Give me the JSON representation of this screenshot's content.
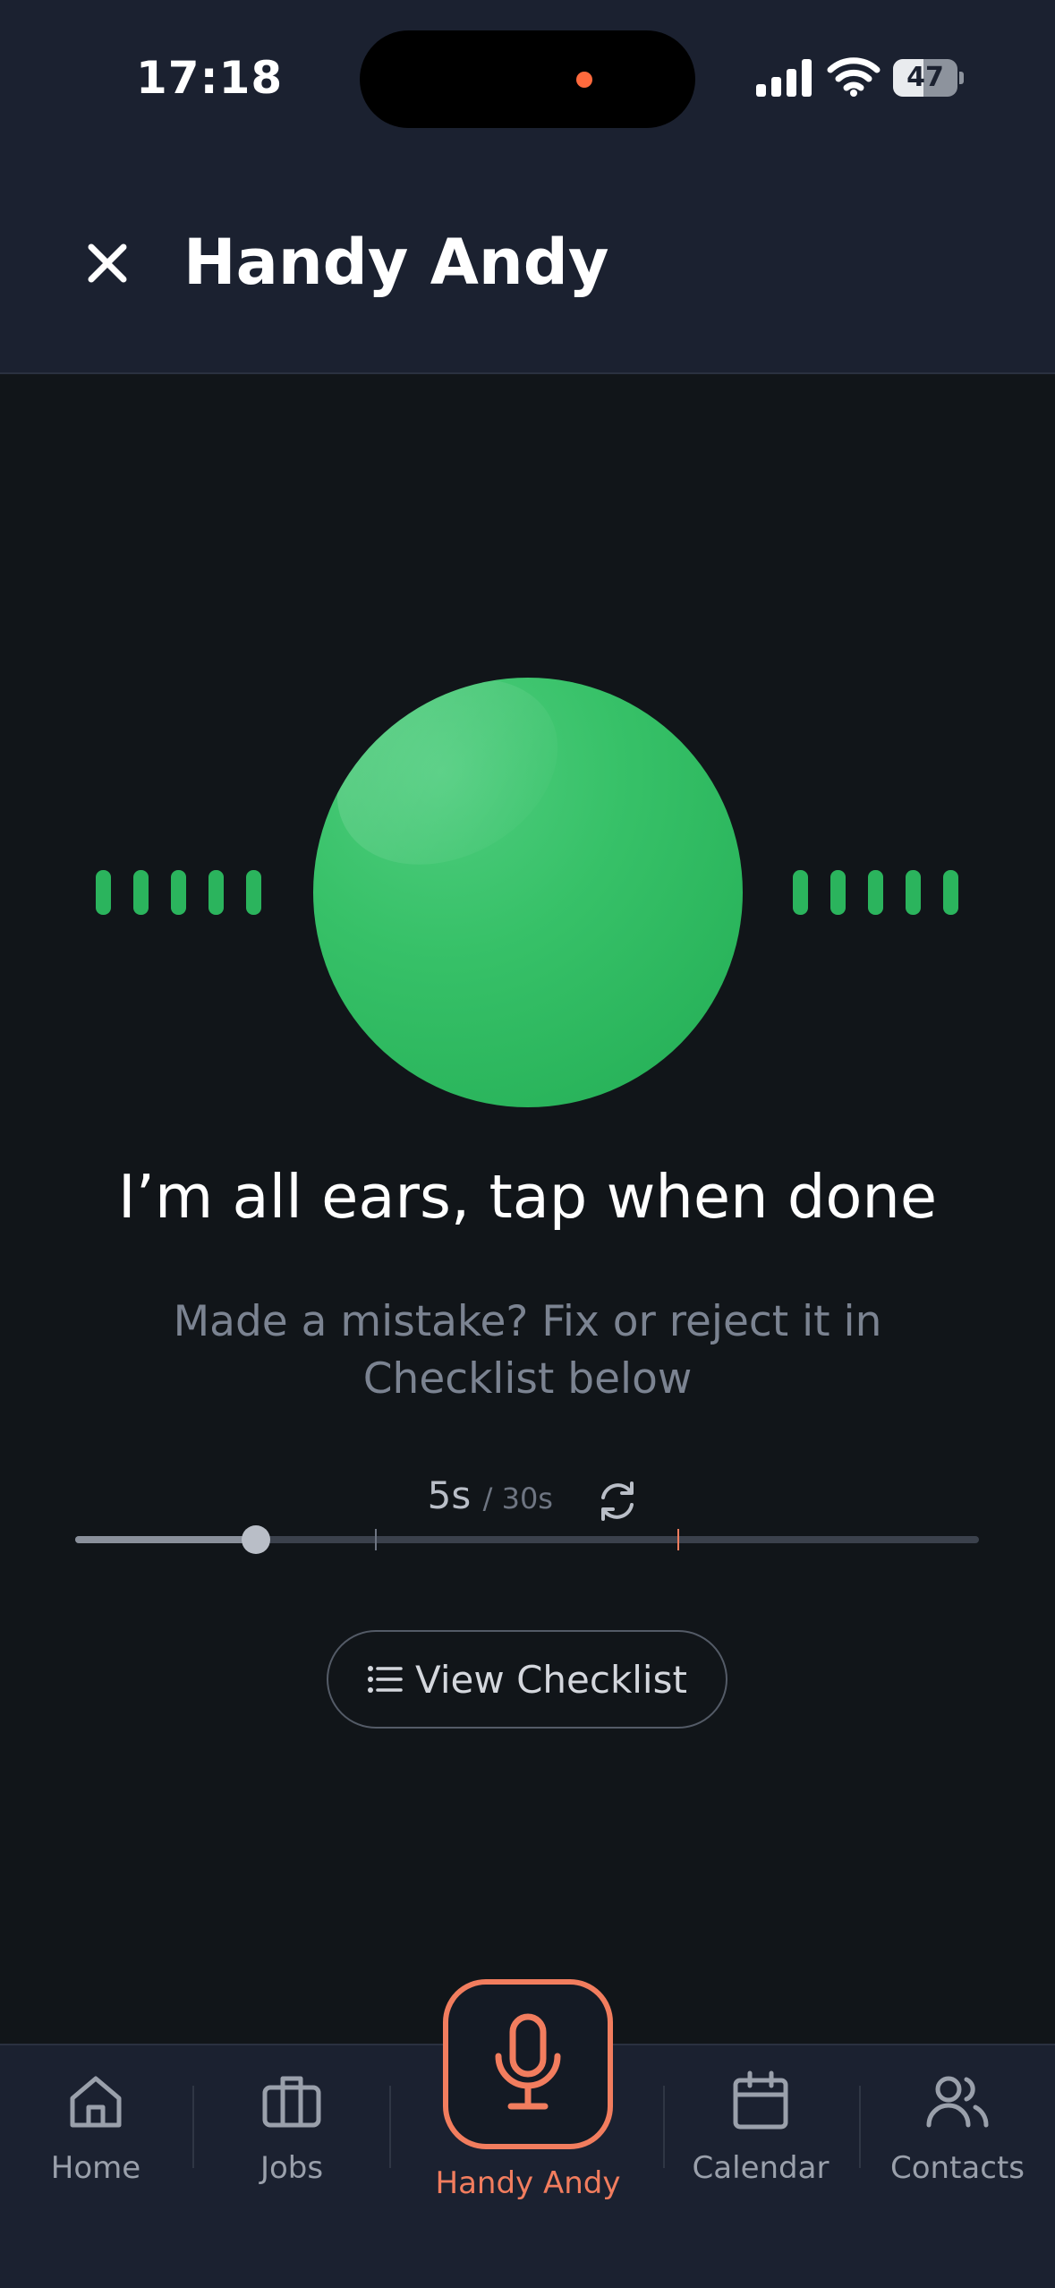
{
  "status_bar": {
    "time": "17:18",
    "battery": "47",
    "battery_level": 0.47
  },
  "header": {
    "title": "Handy Andy"
  },
  "listening": {
    "headline": "I’m all ears, tap when done",
    "subtext": "Made a mistake? Fix or reject it in Checklist below"
  },
  "timer": {
    "elapsed": "5s",
    "total": "/ 30s",
    "progress": 0.2
  },
  "checklist_button": {
    "label": "View Checklist"
  },
  "nav": {
    "home": "Home",
    "jobs": "Jobs",
    "handy_andy": "Handy Andy",
    "calendar": "Calendar",
    "contacts": "Contacts"
  },
  "colors": {
    "accent": "#f27d5e",
    "orb": "#2bb45d",
    "background": "#111519",
    "header_bg": "#1b2130"
  },
  "icons": [
    "close-icon",
    "reset-icon",
    "list-icon",
    "home-icon",
    "briefcase-icon",
    "microphone-icon",
    "calendar-icon",
    "users-icon"
  ]
}
